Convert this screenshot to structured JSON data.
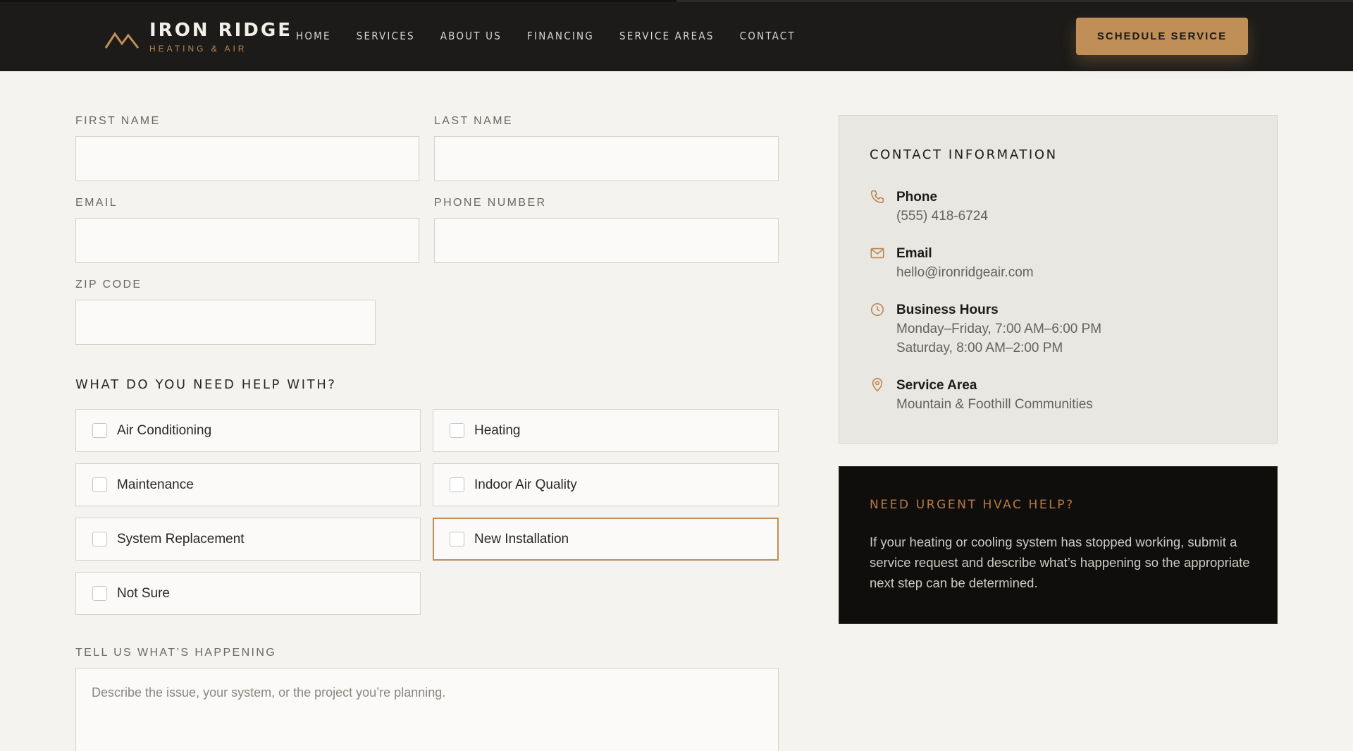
{
  "brand": {
    "name": "IRON RIDGE",
    "tagline": "HEATING & AIR",
    "logo_icon": "mountain-peaks-icon",
    "accent_color": "#c08f58"
  },
  "nav": {
    "items": [
      {
        "label": "HOME"
      },
      {
        "label": "SERVICES"
      },
      {
        "label": "ABOUT US"
      },
      {
        "label": "FINANCING"
      },
      {
        "label": "SERVICE AREAS"
      },
      {
        "label": "CONTACT"
      }
    ],
    "cta_label": "SCHEDULE SERVICE"
  },
  "form": {
    "first_name": {
      "label": "FIRST NAME",
      "value": ""
    },
    "last_name": {
      "label": "LAST NAME",
      "value": ""
    },
    "email": {
      "label": "EMAIL",
      "value": ""
    },
    "phone": {
      "label": "PHONE NUMBER",
      "value": ""
    },
    "zip": {
      "label": "ZIP CODE",
      "value": ""
    },
    "help_title": "WHAT DO YOU NEED HELP WITH?",
    "options": [
      {
        "label": "Air Conditioning",
        "checked": false
      },
      {
        "label": "Heating",
        "checked": false
      },
      {
        "label": "Maintenance",
        "checked": false
      },
      {
        "label": "Indoor Air Quality",
        "checked": false
      },
      {
        "label": "System Replacement",
        "checked": false
      },
      {
        "label": "New Installation",
        "checked": false,
        "focused": true
      },
      {
        "label": "Not Sure",
        "checked": false
      }
    ],
    "details": {
      "label": "TELL US WHAT’S HAPPENING",
      "placeholder": "Describe the issue, your system, or the project you’re planning."
    }
  },
  "contact": {
    "title": "CONTACT INFORMATION",
    "items": [
      {
        "icon": "phone-icon",
        "head": "Phone",
        "lines": [
          "(555) 418-6724"
        ]
      },
      {
        "icon": "mail-icon",
        "head": "Email",
        "lines": [
          "hello@ironridgeair.com"
        ]
      },
      {
        "icon": "clock-icon",
        "head": "Business Hours",
        "lines": [
          "Monday–Friday, 7:00 AM–6:00 PM",
          "Saturday, 8:00 AM–2:00 PM"
        ]
      },
      {
        "icon": "map-pin-icon",
        "head": "Service Area",
        "lines": [
          "Mountain & Foothill Communities"
        ]
      }
    ]
  },
  "urgent": {
    "title": "NEED URGENT HVAC HELP?",
    "text": "If your heating or cooling system has stopped working, submit a service request and describe what’s happening so the appropriate next step can be determined."
  }
}
